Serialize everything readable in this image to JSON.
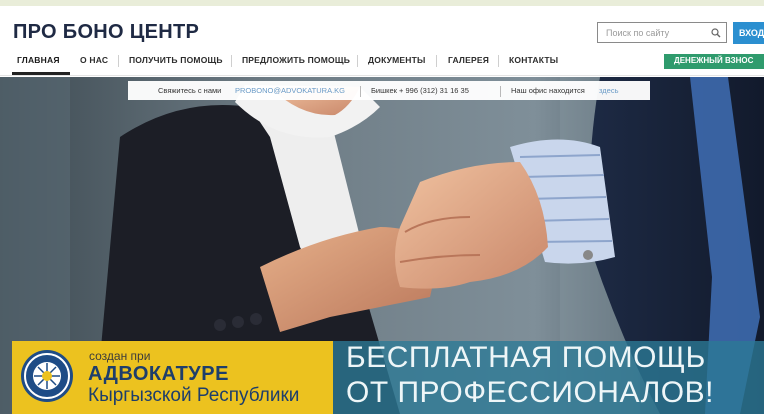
{
  "header": {
    "logo": "ПРО БОНО ЦЕНТР",
    "search_placeholder": "Поиск по сайту",
    "login_label": "ВХОД"
  },
  "nav": {
    "items": [
      {
        "label": "ГЛАВНАЯ",
        "active": true
      },
      {
        "label": "О НАС"
      },
      {
        "label": "ПОЛУЧИТЬ ПОМОЩЬ"
      },
      {
        "label": "ПРЕДЛОЖИТЬ ПОМОЩЬ"
      },
      {
        "label": "ДОКУМЕНТЫ"
      },
      {
        "label": "ГАЛЕРЕЯ"
      },
      {
        "label": "КОНТАКТЫ"
      }
    ],
    "donate_label": "ДЕНЕЖНЫЙ ВЗНОС"
  },
  "contact_strip": {
    "contact_prefix": "Свяжитесь с нами",
    "email": "PROBONO@ADVOKATURA.KG",
    "phone": "Бишкек + 996 (312) 31 16 35",
    "office_prefix": "Наш офис находится",
    "office_link": "здесь"
  },
  "banner": {
    "created_by": "создан при",
    "bar_name": "АДВОКАТУРЕ",
    "republic": "Кыргызской Республики",
    "slogan_line1": "БЕСПЛАТНАЯ ПОМОЩЬ",
    "slogan_line2": "ОТ ПРОФЕССИОНАЛОВ!"
  },
  "colors": {
    "accent_blue": "#2b8fd0",
    "donate_green": "#2f9b6d",
    "banner_yellow": "#ecc21f",
    "banner_teal": "#2c7a96",
    "logo_dark": "#1f2a44"
  },
  "icons": {
    "search": "search-icon",
    "emblem": "bar-emblem-icon"
  }
}
